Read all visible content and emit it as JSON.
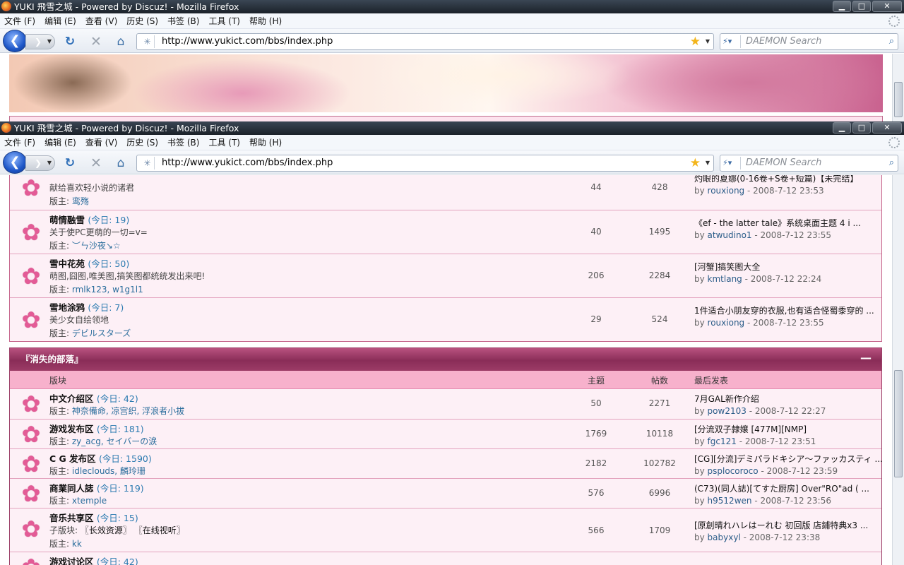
{
  "window": {
    "title": "YUKI 飛雪之城 - Powered by Discuz! - Mozilla Firefox",
    "minimize": "▁",
    "maximize": "□",
    "close": "✕"
  },
  "menu": {
    "file": "文件 (F)",
    "edit": "编辑 (E)",
    "view": "查看 (V)",
    "history": "历史 (S)",
    "bookmarks": "书签 (B)",
    "tools": "工具 (T)",
    "help": "帮助 (H)"
  },
  "nav": {
    "url": "http://www.yukict.com/bbs/index.php",
    "search_placeholder": "DAEMON Search"
  },
  "section1_rows": [
    {
      "name": "",
      "today": "",
      "desc": "献给喜欢轻小说的诸君",
      "mod_label": "版主:",
      "mods": "鸾殇",
      "topics": "44",
      "posts": "428",
      "last_title": "灼眼的夏娜(0-16卷+S卷+短篇)【未完结】",
      "last_user": "rouxiong",
      "last_time": "- 2008-7-12 23:53"
    },
    {
      "name": "萌情融雪",
      "today": "(今日: 19)",
      "desc": "关于使PC更萌的一切=v=",
      "mod_label": "版主:",
      "mods": "︶ㄣ沙夜↘☆",
      "topics": "40",
      "posts": "1495",
      "last_title": "《ef - the latter tale》系统桌面主题 4 i ...",
      "last_user": "atwudino1",
      "last_time": "- 2008-7-12 23:55"
    },
    {
      "name": "雪中花苑",
      "today": "(今日: 50)",
      "desc": "萌图,囧图,唯美图,搞笑图都统统发出来吧!",
      "mod_label": "版主:",
      "mods": "rmlk123, w1g1l1",
      "topics": "206",
      "posts": "2284",
      "last_title": "[河蟹]搞笑图大全",
      "last_user": "kmtlang",
      "last_time": "- 2008-7-12 22:24"
    },
    {
      "name": "雪地涂鸦",
      "today": "(今日: 7)",
      "desc": "美少女自绘领地",
      "mod_label": "版主:",
      "mods": "デビルスターズ",
      "topics": "29",
      "posts": "524",
      "last_title": "1件适合小朋友穿的衣服,也有适合怪蜀黍穿的 ...",
      "last_user": "rouxiong",
      "last_time": "- 2008-7-12 23:55"
    }
  ],
  "section2": {
    "title": "『消失的部落』",
    "collapse": "—",
    "col_forum": "版块",
    "col_topics": "主题",
    "col_posts": "帖数",
    "col_last": "最后发表",
    "rows": [
      {
        "name": "中文介绍区",
        "today": "(今日: 42)",
        "mod_label": "版主:",
        "mods": "神奈備命, 凉宫织, 浮浪者小拔",
        "topics": "50",
        "posts": "2271",
        "last_title": "7月GAL新作介绍",
        "last_user": "pow2103",
        "last_time": "- 2008-7-12 22:27"
      },
      {
        "name": "游戏发布区",
        "today": "(今日: 181)",
        "mod_label": "版主:",
        "mods": "zy_acg, セイバーの涙",
        "topics": "1769",
        "posts": "10118",
        "last_title": "[分流双子隷嬢 [477M][NMP]",
        "last_user": "fgc121",
        "last_time": "- 2008-7-12 23:51"
      },
      {
        "name": "C G 发布区",
        "today": "(今日: 1590)",
        "mod_label": "版主:",
        "mods": "idleclouds, 麟玲珊",
        "topics": "2182",
        "posts": "102782",
        "last_title": "[CG][分流]デミパラドキシア〜ファッカスティ ...",
        "last_user": "psplocoroco",
        "last_time": "- 2008-7-12 23:59"
      },
      {
        "name": "商業同人誌",
        "today": "(今日: 119)",
        "mod_label": "版主:",
        "mods": "xtemple",
        "topics": "576",
        "posts": "6996",
        "last_title": "(C73)(同人誌)[てすた厨房] Over\"RO\"ad ( ...",
        "last_user": "h9512wen",
        "last_time": "- 2008-7-12 23:56"
      }
    ],
    "music": {
      "name": "音乐共享区",
      "today": "(今日: 15)",
      "sub_label": "子版块:",
      "subs": "〖长效资源〗 〖在线视听〗",
      "mod_label": "版主:",
      "mods": "kk",
      "topics": "566",
      "posts": "1709",
      "last_title": "[原創晴れハレはーれむ 初回版 店鋪特典x3 ...",
      "last_user": "babyxyl",
      "last_time": "- 2008-7-12 23:38"
    },
    "partial": {
      "name": "游戏讨论区",
      "today": "(今日: 42)"
    }
  },
  "colors": {
    "accent": "#9c3b66",
    "row_bg": "#fdf0f6",
    "link": "#2a6d9c"
  }
}
